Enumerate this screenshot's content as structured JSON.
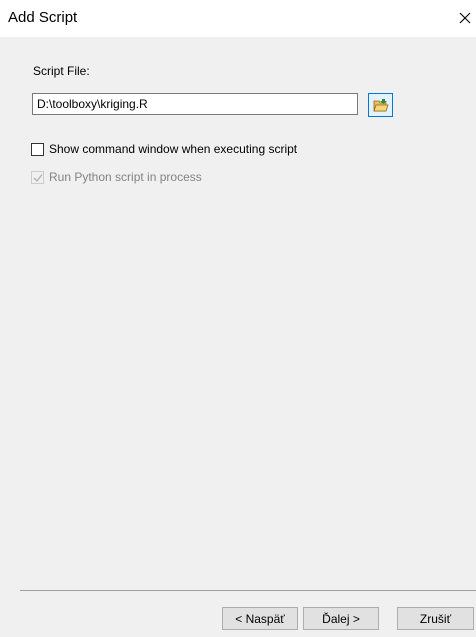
{
  "window": {
    "title": "Add Script"
  },
  "form": {
    "script_file_label": "Script File:",
    "script_file_value": "D:\\toolboxy\\kriging.R",
    "show_command_window": {
      "label": "Show command window when executing script",
      "checked": false
    },
    "run_python_in_process": {
      "label": "Run Python script in process",
      "checked": true,
      "enabled": false
    }
  },
  "buttons": {
    "back": "< Naspäť",
    "next": "Ďalej >",
    "cancel": "Zrušiť"
  },
  "icons": {
    "close": "close-icon",
    "browse": "folder-open-icon",
    "check": "checkmark-icon"
  }
}
